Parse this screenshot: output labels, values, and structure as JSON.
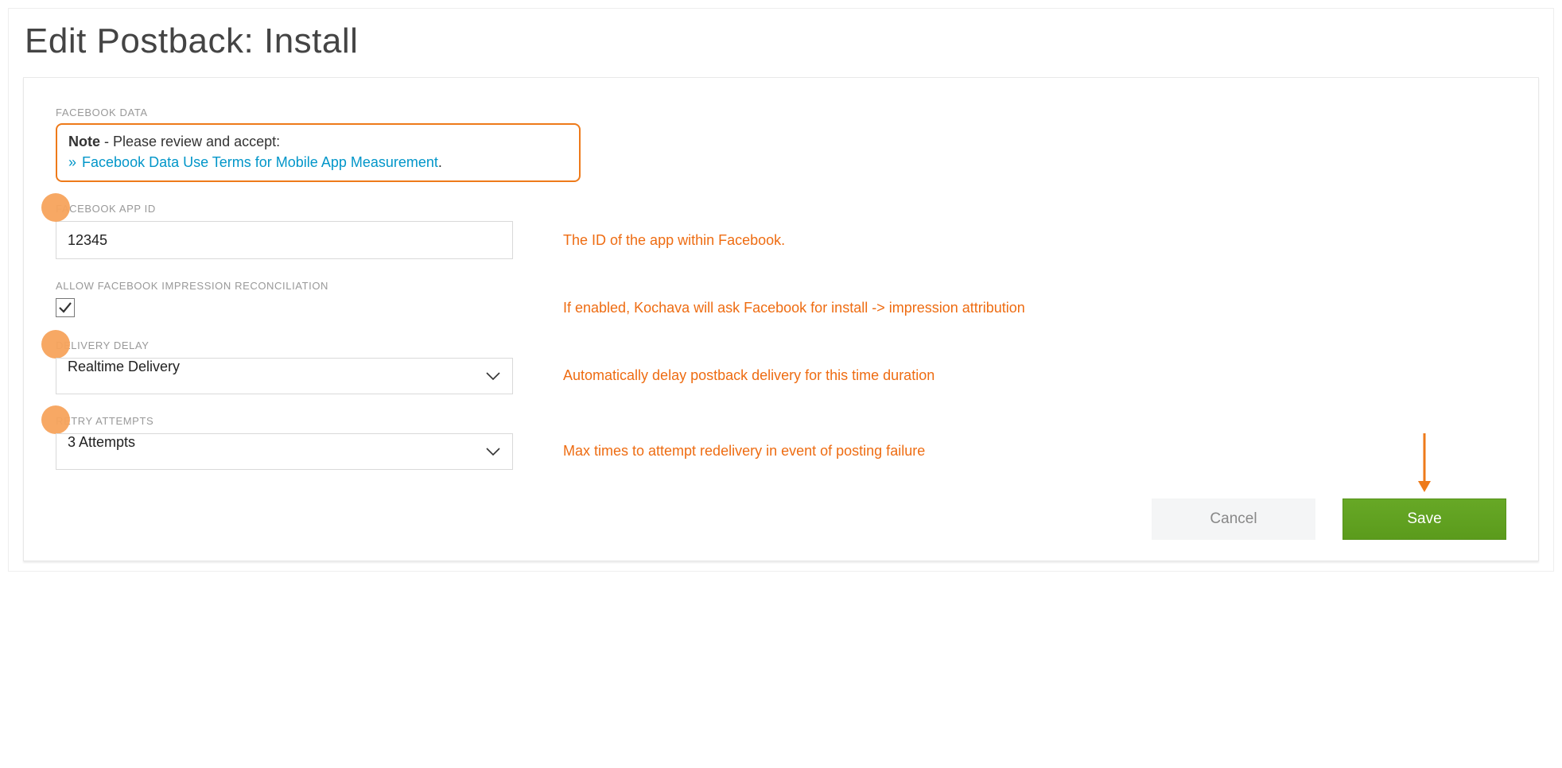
{
  "page": {
    "title": "Edit Postback: Install"
  },
  "facebookData": {
    "sectionLabel": "FACEBOOK DATA",
    "notePrefix": "Note",
    "noteLead": " - Please review and accept:",
    "linkText": "Facebook Data Use Terms for Mobile App Measurement",
    "period": "."
  },
  "appId": {
    "label": "FACEBOOK APP ID",
    "value": "12345",
    "help": "The ID of the app within Facebook."
  },
  "impression": {
    "label": "ALLOW FACEBOOK IMPRESSION RECONCILIATION",
    "checked": true,
    "help": "If enabled, Kochava will ask Facebook for install -> impression attribution"
  },
  "delay": {
    "label": "DELIVERY DELAY",
    "value": "Realtime Delivery",
    "help": "Automatically delay postback delivery for this time duration"
  },
  "retry": {
    "label": "RETRY ATTEMPTS",
    "value": "3 Attempts",
    "help": "Max times to attempt redelivery in event of posting failure"
  },
  "actions": {
    "cancel": "Cancel",
    "save": "Save"
  },
  "colors": {
    "accent": "#ee7a1a",
    "link": "#0296c9",
    "primary": "#5a9e1b"
  }
}
